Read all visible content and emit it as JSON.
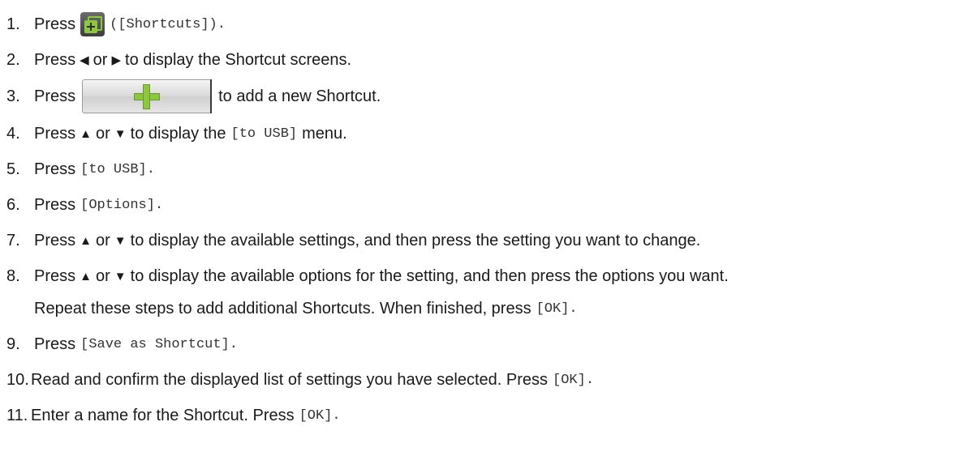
{
  "steps": {
    "s1": {
      "num": "1.",
      "press": "Press",
      "icon": "shortcuts-icon",
      "code": "([Shortcuts])."
    },
    "s2": {
      "num": "2.",
      "press": "Press",
      "left_symbol": "◀",
      "or": "or",
      "right_symbol": "▶",
      "rest": "to display the Shortcut screens."
    },
    "s3": {
      "num": "3.",
      "press": "Press",
      "button_icon": "plus-icon",
      "rest": "to add a new Shortcut."
    },
    "s4": {
      "num": "4.",
      "press": "Press",
      "up_symbol": "▲",
      "or": "or",
      "down_symbol": "▼",
      "mid": "to display the",
      "code": "[to USB]",
      "rest": "menu."
    },
    "s5": {
      "num": "5.",
      "press": "Press",
      "code": "[to USB]."
    },
    "s6": {
      "num": "6.",
      "press": "Press",
      "code": "[Options]."
    },
    "s7": {
      "num": "7.",
      "press": "Press",
      "up_symbol": "▲",
      "or": "or",
      "down_symbol": "▼",
      "rest": "to display the available settings, and then press the setting you want to change."
    },
    "s8": {
      "num": "8.",
      "press": "Press",
      "up_symbol": "▲",
      "or": "or",
      "down_symbol": "▼",
      "rest": "to display the available options for the setting, and then press the options you want."
    },
    "s8b": {
      "text": "Repeat these steps to add additional Shortcuts. When finished, press",
      "code": "[OK]."
    },
    "s9": {
      "num": "9.",
      "press": "Press",
      "code": "[Save as Shortcut]."
    },
    "s10": {
      "num": "10.",
      "text": "Read and confirm the displayed list of settings you have selected. Press",
      "code": "[OK]."
    },
    "s11": {
      "num": "11.",
      "text": "Enter a name for the Shortcut. Press",
      "code": "[OK]."
    }
  }
}
